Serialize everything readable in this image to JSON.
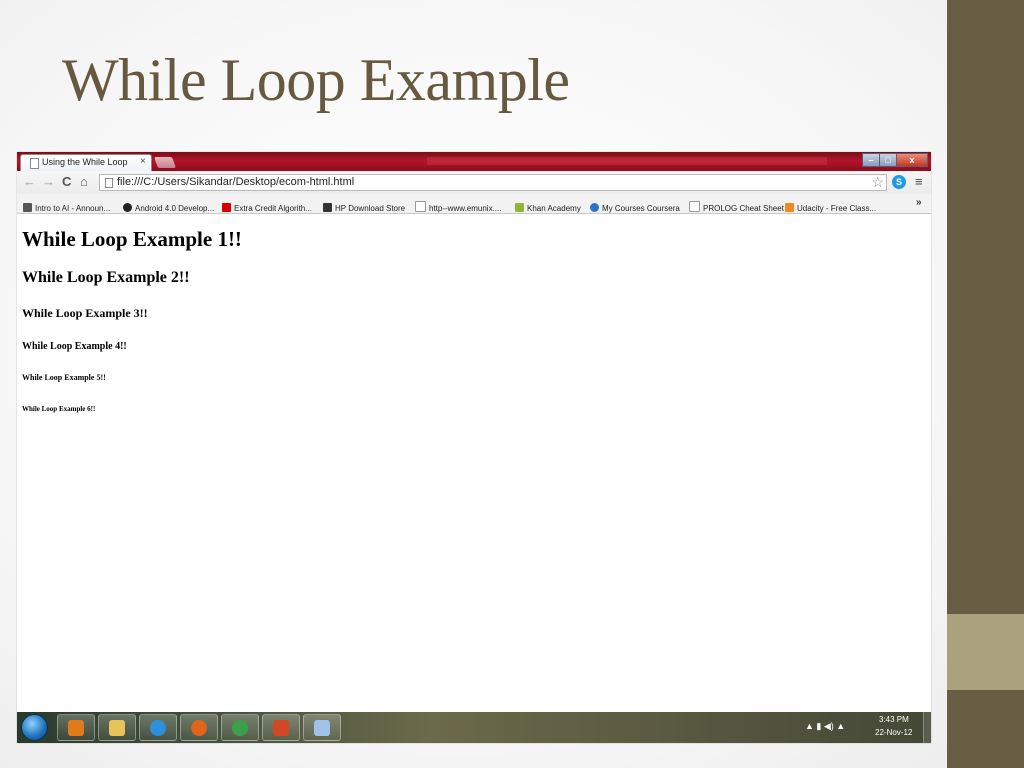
{
  "slide": {
    "title": "While Loop Example"
  },
  "browser": {
    "tab_title": "Using the While Loop",
    "tab_close": "×",
    "window_controls": {
      "minimize": "–",
      "maximize": "□",
      "close": "x"
    },
    "url": "file:///C:/Users/Sikandar/Desktop/ecom-html.html",
    "bookmarks": [
      {
        "label": "Intro to AI - Announ...",
        "icon": "ai-icon",
        "color": "#555555"
      },
      {
        "label": "Android 4.0 Develop...",
        "icon": "android-icon",
        "color": "#222222"
      },
      {
        "label": "Extra Credit Algorith...",
        "icon": "udacity-icon",
        "color": "#d40000"
      },
      {
        "label": "HP Download Store",
        "icon": "hp-icon",
        "color": "#333333"
      },
      {
        "label": "http--www.emunix....",
        "icon": "page-icon",
        "color": "#ffffff"
      },
      {
        "label": "Khan Academy",
        "icon": "leaf-icon",
        "color": "#8cb83a"
      },
      {
        "label": "My Courses Coursera",
        "icon": "coursera-icon",
        "color": "#2a73c9"
      },
      {
        "label": "PROLOG Cheat Sheet",
        "icon": "page-icon",
        "color": "#ffffff"
      },
      {
        "label": "Udacity - Free Class...",
        "icon": "udacity-u-icon",
        "color": "#f08a1e"
      }
    ],
    "bookmarks_more": "»",
    "headings": [
      "While Loop Example 1!!",
      "While Loop Example 2!!",
      "While Loop Example 3!!",
      "While Loop Example 4!!",
      "While Loop Example 5!!",
      "While Loop Example 6!!"
    ]
  },
  "taskbar": {
    "apps": [
      {
        "name": "media-player-icon",
        "color": "#e07a1a"
      },
      {
        "name": "file-explorer-icon",
        "color": "#e8c35a"
      },
      {
        "name": "internet-explorer-icon",
        "color": "#2d8fe0"
      },
      {
        "name": "firefox-icon",
        "color": "#e0641a"
      },
      {
        "name": "chrome-icon",
        "color": "#3aa14a"
      },
      {
        "name": "powerpoint-icon",
        "color": "#d24726"
      },
      {
        "name": "notepad-icon",
        "color": "#9fc3e8"
      }
    ],
    "time": "3:43 PM",
    "date": "22-Nov-12"
  },
  "colors": {
    "title_text": "#67593f",
    "side_band": "#685d43",
    "side_accent": "#a9a27c",
    "chrome_titlebar": "#b4142a"
  }
}
